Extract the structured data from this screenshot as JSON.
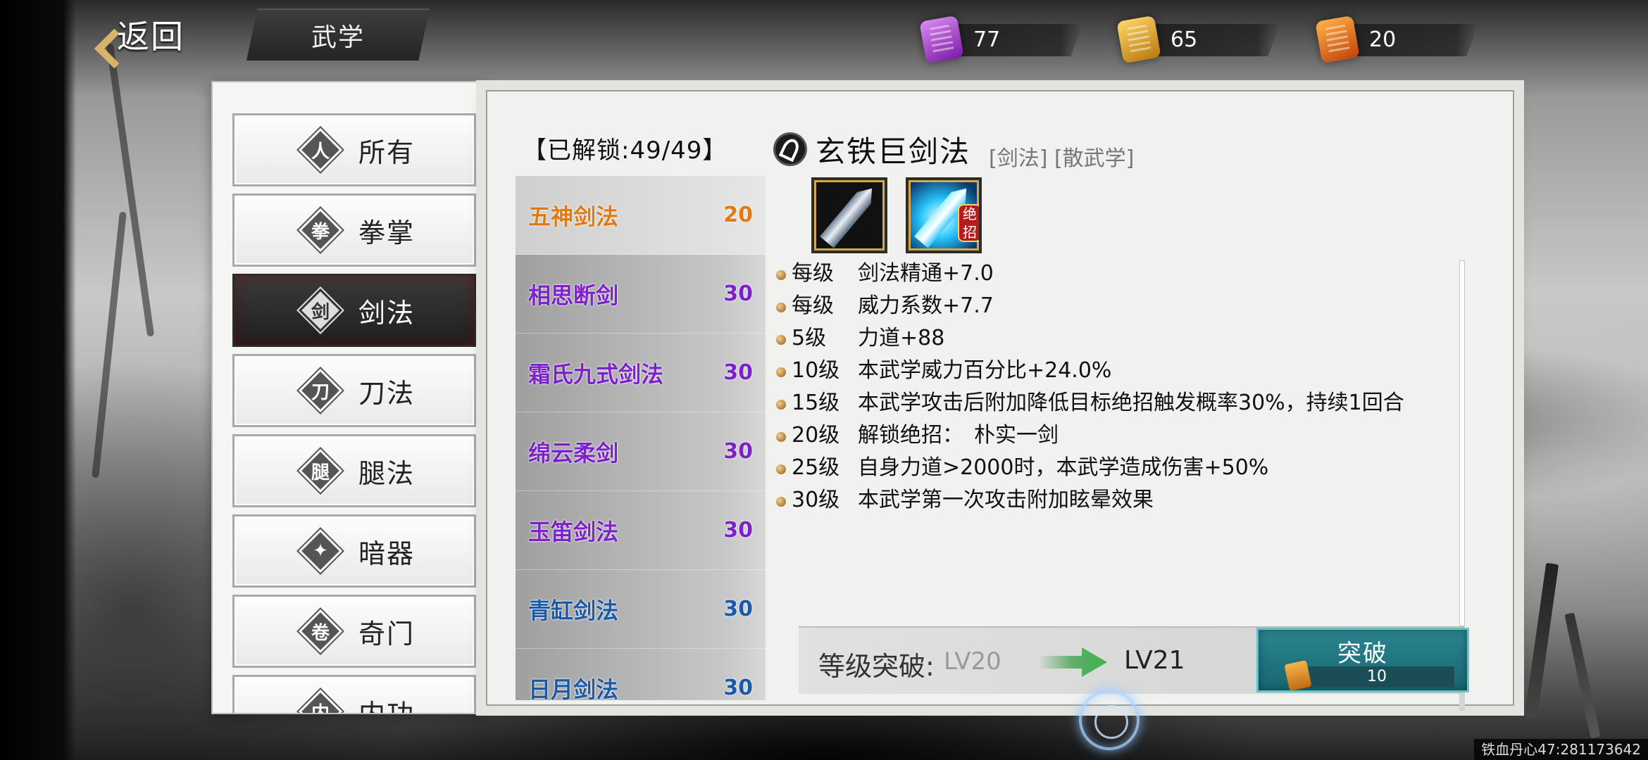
{
  "topbar": {
    "back_label": "返回",
    "title": "武学"
  },
  "resources": [
    {
      "name": "purple-scroll-icon",
      "value": "77",
      "color": "#b24bd6"
    },
    {
      "name": "gold-scroll-icon",
      "value": "65",
      "color": "#e0a21c"
    },
    {
      "name": "flame-scroll-icon",
      "value": "20",
      "color": "#e0621c"
    }
  ],
  "categories": [
    {
      "label": "所有",
      "icon": "meditation-icon",
      "glyph": "人"
    },
    {
      "label": "拳掌",
      "icon": "fist-icon",
      "glyph": "拳"
    },
    {
      "label": "剑法",
      "icon": "sword-icon",
      "glyph": "剑",
      "active": true
    },
    {
      "label": "刀法",
      "icon": "blade-icon",
      "glyph": "刀"
    },
    {
      "label": "腿法",
      "icon": "kick-icon",
      "glyph": "腿"
    },
    {
      "label": "暗器",
      "icon": "shuriken-icon",
      "glyph": "✦"
    },
    {
      "label": "奇门",
      "icon": "scroll-icon",
      "glyph": "卷"
    },
    {
      "label": "内功",
      "icon": "inner-power-icon",
      "glyph": "内"
    }
  ],
  "skill_list": {
    "header": "【已解锁:49/49】",
    "items": [
      {
        "name": "五神剑法",
        "level": "20",
        "color": "#e07a12",
        "selected": true
      },
      {
        "name": "相思断剑",
        "level": "30",
        "color": "#7b22c8"
      },
      {
        "name": "霜氏九式剑法",
        "level": "30",
        "color": "#7b22c8"
      },
      {
        "name": "绵云柔剑",
        "level": "30",
        "color": "#7b22c8"
      },
      {
        "name": "玉笛剑法",
        "level": "30",
        "color": "#7b22c8"
      },
      {
        "name": "青缸剑法",
        "level": "30",
        "color": "#1b5aa8"
      },
      {
        "name": "日月剑法",
        "level": "30",
        "color": "#1b5aa8"
      }
    ]
  },
  "detail": {
    "title": "玄铁巨剑法",
    "tags": "[剑法] [散武学]",
    "ult_badge": [
      "绝",
      "招"
    ],
    "effects": [
      {
        "lv": "每级",
        "text": "剑法精通+7.0"
      },
      {
        "lv": "每级",
        "text": "威力系数+7.7"
      },
      {
        "lv": "5级",
        "text": "力道+88"
      },
      {
        "lv": "10级",
        "text": "本武学威力百分比+24.0%"
      },
      {
        "lv": "15级",
        "text": "本武学攻击后附加降低目标绝招触发概率30%，持续1回合"
      },
      {
        "lv": "20级",
        "text": "解锁绝招：　朴实一剑"
      },
      {
        "lv": "25级",
        "text": "自身力道>2000时，本武学造成伤害+50%"
      },
      {
        "lv": "30级",
        "text": "本武学第一次攻击附加眩晕效果"
      }
    ]
  },
  "breakthrough": {
    "label": "等级突破:",
    "from": "LV20",
    "to": "LV21",
    "button_label": "突破",
    "cost": "10"
  },
  "watermark": "铁血丹心47:281173642"
}
